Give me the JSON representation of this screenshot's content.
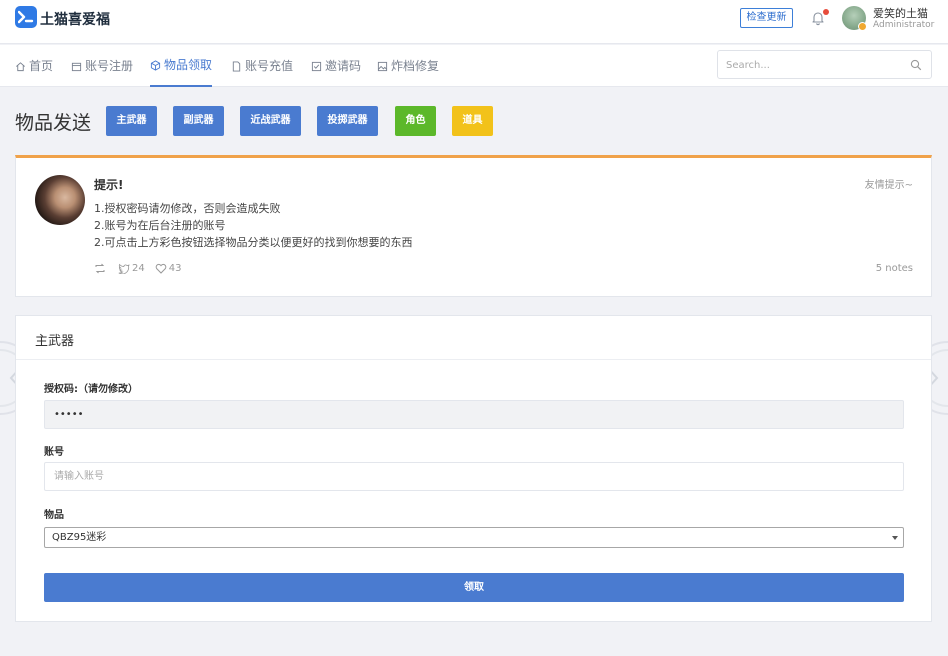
{
  "header": {
    "app_name": "土猫喜爱福",
    "check_update_label": "检查更新",
    "user_name": "爱笑的土猫",
    "user_role": "Administrator"
  },
  "nav": {
    "items": [
      {
        "label": "首页",
        "icon": "home-icon"
      },
      {
        "label": "账号注册",
        "icon": "calendar-icon"
      },
      {
        "label": "物品领取",
        "icon": "box-icon",
        "active": true
      },
      {
        "label": "账号充值",
        "icon": "file-icon"
      },
      {
        "label": "邀请码",
        "icon": "check-square-icon"
      },
      {
        "label": "炸档修复",
        "icon": "image-icon"
      }
    ],
    "search_placeholder": "Search..."
  },
  "page": {
    "title": "物品发送",
    "categories": [
      {
        "label": "主武器",
        "color": "#4a7bd0"
      },
      {
        "label": "副武器",
        "color": "#4a7bd0"
      },
      {
        "label": "近战武器",
        "color": "#4a7bd0"
      },
      {
        "label": "投掷武器",
        "color": "#4a7bd0"
      },
      {
        "label": "角色",
        "color": "#5cb82a"
      },
      {
        "label": "道具",
        "color": "#f2c21a"
      }
    ]
  },
  "tip": {
    "title": "提示!",
    "lines": [
      "1.授权密码请勿修改，否则会造成失败",
      "2.账号为在后台注册的账号",
      "2.可点击上方彩色按钮选择物品分类以便更好的找到你想要的东西"
    ],
    "hint": "友情提示~",
    "retweets": "",
    "shares": "24",
    "likes": "43",
    "notes": "5 notes",
    "accent_color": "#f0a24a"
  },
  "form": {
    "heading": "主武器",
    "auth_label": "授权码:（请勿修改）",
    "auth_value": "•••••",
    "account_label": "账号",
    "account_placeholder": "请输入账号",
    "item_label": "物品",
    "item_selected": "QBZ95迷彩",
    "submit_label": "领取"
  }
}
